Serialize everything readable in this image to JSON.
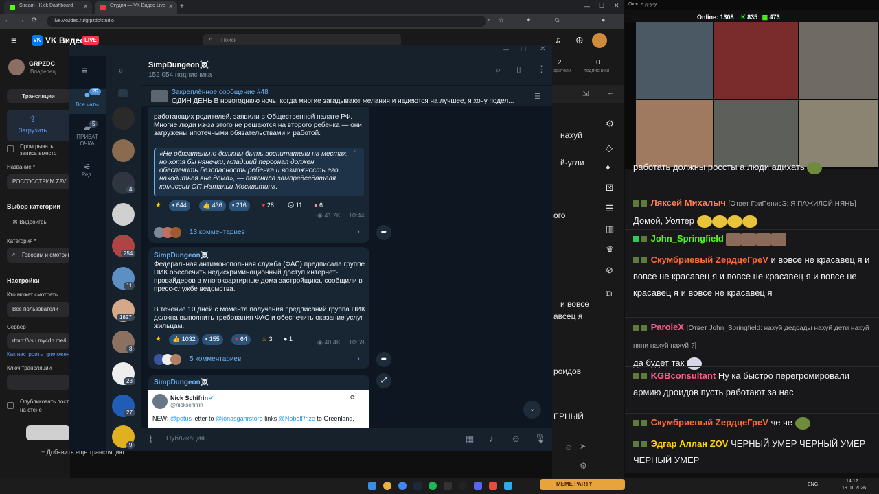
{
  "browser": {
    "tabs": [
      {
        "label": "Stream - Kick Dashboard",
        "fav": "#53fc18"
      },
      {
        "label": "Студия — VK Видео Live",
        "fav": "#ff3347"
      }
    ],
    "url": "live.vkvideo.ru/grpzdc/studio"
  },
  "vk": {
    "logo": "VK",
    "title": "VK Видео",
    "live": "LIVE",
    "search_placeholder": "Поиск"
  },
  "studio": {
    "channel_name": "GRPZDC",
    "channel_role": "Владелец",
    "tab_streams": "Трансляции",
    "upload_label": "Загрузить",
    "play_inside_label": "Проигрывать запись вместо обложки",
    "name_label": "Название *",
    "name_value": "РОСГОССТРИМ ZAV",
    "category_section": "Выбор категории",
    "category_videogames": "Видеоигры",
    "category_label": "Категория *",
    "category_value": "Говорим и смотрим",
    "settings_section": "Настройки",
    "who_can_watch_label": "Кто может смотреть",
    "who_can_watch_value": "Все пользователи",
    "server_label": "Сервер",
    "server_value": "rtmp://vsu.mycdn.me/i",
    "how_to_setup": "Как настроить приложение",
    "key_label": "Ключ трансляции",
    "publish_label": "Опубликовать пост на стене сообщества",
    "add_stream": "Добавить еще трансляцию",
    "stats_left_value": "2",
    "stats_left_label": "зрители",
    "stats_mid_label": "зрители",
    "stats_right_value": "0",
    "stats_right_label": "подписчики",
    "right_chat_fragments": [
      "нахуй",
      "й-угли",
      "ого",
      "и вовсе",
      "авсец я",
      "роидов",
      "ЕРНЫЙ"
    ]
  },
  "telegram": {
    "folders": [
      {
        "label": "Все чаты",
        "count": "25"
      },
      {
        "label": "ПРИВАТ ОЧКА",
        "count": "5"
      },
      {
        "label": "Ред.",
        "count": ""
      }
    ],
    "chat_counts": [
      "4",
      "254",
      "11",
      "1827",
      "8",
      "23",
      "27",
      "9"
    ],
    "channel": {
      "name": "SimpDungeon☠️",
      "subscribers": "152 054 подписчика"
    },
    "pinned": {
      "title": "Закреплённое сообщение #48",
      "text": "ОДИН ДЕНЬ  В новогоднюю ночь, когда многие загадывают желания и надеются на лучшее, я хочу подел..."
    },
    "post1": {
      "text": "работающих родителей, заявили в Общественной палате РФ. Многие люди из-за этого не решаются на второго ребенка — они загружены ипотечными обязательствами и работой.",
      "quote": "«Не обязательно должны быть воспитатели на местах, но хотя бы нянечки, младший персонал должен обеспечить безопасность ребенка и возможность его находиться вне дома», — пояснила зампредседателя комиссии ОП Натальи Москвитина.",
      "reactions": [
        "644",
        "436",
        "216",
        "28",
        "11",
        "6"
      ],
      "views": "41.2K",
      "time": "10:44",
      "comments": "13 комментариев"
    },
    "post2": {
      "author": "SimpDungeon☠️",
      "text": "Федеральная антимонопольная служба (ФАС) предписала группе ПИК обеспечить недискриминационный доступ интернет-провайдеров в многоквартирные дома застройщика, сообщили в пресс-службе ведомства.",
      "text2": "В течение 10 дней с момента получения предписаний группа ПИК должна выполнить требования ФАС и обеспечить оказание услуг жильцам.",
      "reactions": [
        "1032",
        "155",
        "64",
        "3",
        "1"
      ],
      "views": "40.4K",
      "time": "10:59",
      "comments": "5 комментариев"
    },
    "post3": {
      "author": "SimpDungeon☠️",
      "tweet_name": "Nick Schifrin",
      "tweet_handle": "@nickschifrin",
      "tweet_text_a": "NEW: ",
      "tweet_m1": "@potus",
      "tweet_text_b": " letter to ",
      "tweet_m2": "@jonasgahrstore",
      "tweet_text_c": " links ",
      "tweet_m3": "@NobelPrize",
      "tweet_text_d": " to Greenland,"
    },
    "compose_placeholder": "Публикация..."
  },
  "stream": {
    "online_label": "Online:",
    "online_value": "1308",
    "kick_count": "835",
    "follow_count": "473"
  },
  "chat": [
    {
      "user": "",
      "reply": "",
      "text": "работать должны россты а люди адихать",
      "color": "#ffffff"
    },
    {
      "user": "Ляксей Михалыч",
      "reply": "[Ответ ГриПенисЭ: Я ПАЖИЛОЙ НЯНЬ]",
      "text": "Домой, Уолтер",
      "color": "#ff7f50"
    },
    {
      "user": "John_Springfield",
      "reply": "",
      "text": "",
      "color": "#53fc18"
    },
    {
      "user": "Скумбриевый ZердцеГреV",
      "reply": "",
      "text": "и вовсе не красавец я  и вовсе не красавец я  и вовсе не красавец я  и вовсе не красавец я  и вовсе не красавец я",
      "color": "#ff6b35"
    },
    {
      "user": "ParoleX",
      "reply": "[Ответ John_Springfield: нахуй дедсады нахуй дети нахуй няни нахуй нахуй ?]",
      "text": "да будет так",
      "color": "#ff5c8a"
    },
    {
      "user": "KGBconsultant",
      "reply": "",
      "text": "Ну ка быстро перегромировали армию дроидов пусть работают за нас",
      "color": "#ff5c8a"
    },
    {
      "user": "Скумбриевый ZердцеГреV",
      "reply": "",
      "text": "че че",
      "color": "#ff6b35"
    },
    {
      "user": "Эдгар Аллан ZOV",
      "reply": "",
      "text": "ЧЕРНЫЙ УМЕР  ЧЕРНЫЙ УМЕР  ЧЕРНЫЙ УМЕР",
      "color": "#ffd700"
    }
  ],
  "taskbar": {
    "lang": "ENG",
    "time": "14:12",
    "date": "19.01.2026",
    "meme": "MEME PARTY"
  },
  "overlay_title": "Окно в другу"
}
